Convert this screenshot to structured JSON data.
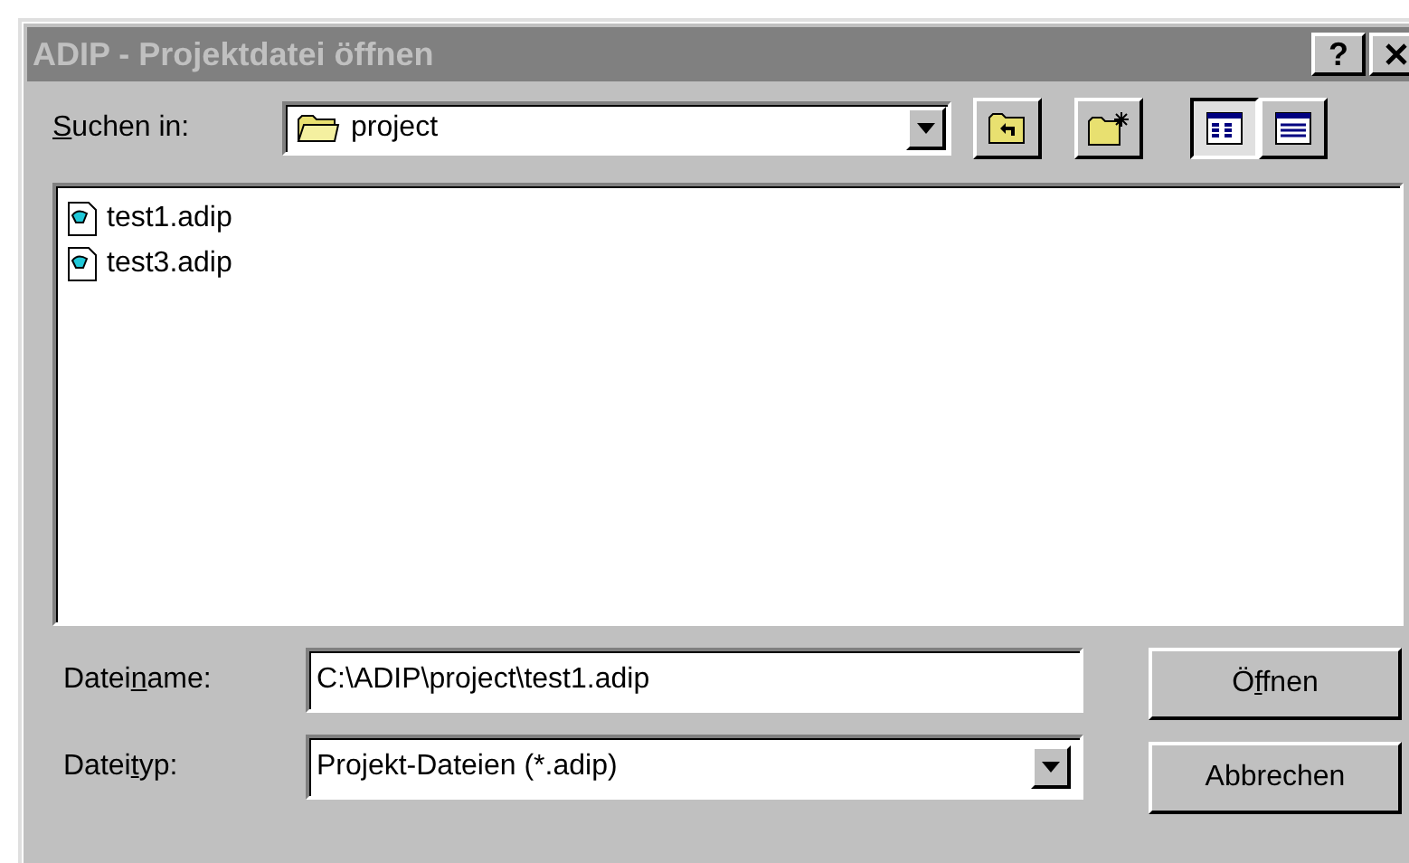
{
  "window": {
    "title": "ADIP - Projektdatei öffnen",
    "help_button": "?"
  },
  "look_in": {
    "access_key": "S",
    "label_post": "uchen in:",
    "value": "project"
  },
  "toolbar": [
    {
      "kind": "up",
      "selected": false
    },
    {
      "kind": "newfolder",
      "selected": false
    },
    {
      "kind": "list",
      "selected": true
    },
    {
      "kind": "details",
      "selected": false
    }
  ],
  "files": [
    {
      "name": "test1.adip"
    },
    {
      "name": "test3.adip"
    }
  ],
  "file_name": {
    "label_pre": "Datei",
    "access_key": "n",
    "label_post": "ame:",
    "value": "C:\\ADIP\\project\\test1.adip"
  },
  "file_type": {
    "label_pre": "Datei",
    "access_key": "t",
    "label_post": "yp:",
    "value": "Projekt-Dateien (*.adip)"
  },
  "buttons": [
    {
      "label_pre": "Ö",
      "access_key": "f",
      "label_post": "fnen"
    },
    {
      "label_pre": "Abbrechen"
    }
  ]
}
